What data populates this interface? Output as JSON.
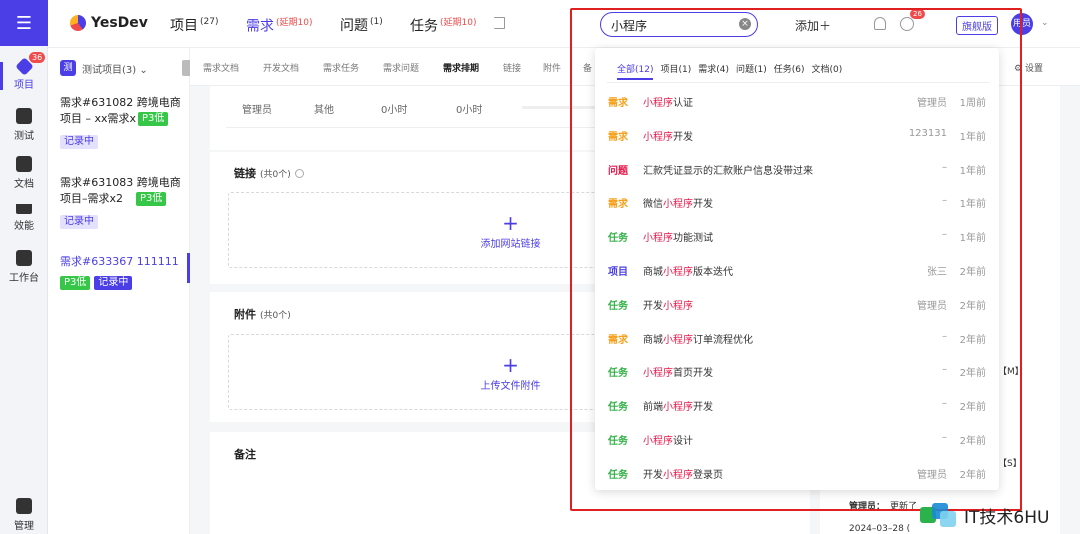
{
  "rail": {
    "badge": "36",
    "items": [
      {
        "label": "项目",
        "icon": "project-icon"
      },
      {
        "label": "测试",
        "icon": "test-icon"
      },
      {
        "label": "文档",
        "icon": "doc-icon"
      },
      {
        "label": "效能",
        "icon": "efficiency-icon"
      },
      {
        "label": "工作台",
        "icon": "workbench-icon"
      },
      {
        "label": "管理",
        "icon": "manage-icon"
      }
    ]
  },
  "topbar": {
    "brand": "YesDev",
    "nav": [
      {
        "label": "项目",
        "count": "(27)",
        "delay": ""
      },
      {
        "label": "需求",
        "count": "",
        "delay": "(延期10)"
      },
      {
        "label": "问题",
        "count": "(1)",
        "delay": ""
      },
      {
        "label": "任务",
        "count": "",
        "delay": "(延期10)"
      }
    ],
    "search_value": "小程序",
    "search_clear": "×",
    "add_label": "添加＋",
    "clock_badge": "26",
    "edition": "旗舰版",
    "avatar": "用员"
  },
  "list": {
    "project_icon": "测",
    "project_label": "测试项目(3) ⌄",
    "items": [
      {
        "title": "需求#631082 跨境电商项目 – xx需求x",
        "priority": "P3低",
        "status": "记录中"
      },
      {
        "title": "需求#631083 跨境电商项目–需求x2",
        "priority": "P3低",
        "status": "记录中"
      },
      {
        "title": "需求#633367 111111",
        "priority": "P3低",
        "status": "记录中"
      }
    ]
  },
  "tabs": [
    "需求文档",
    "开发文档",
    "需求任务",
    "需求问题",
    "需求排期",
    "链接",
    "附件",
    "备"
  ],
  "settings_label": "设置",
  "main": {
    "row": [
      "管理员",
      "其他",
      "0小时",
      "0小时"
    ],
    "links_title": "链接",
    "links_count": "(共0个)",
    "add_link": "添加网站链接",
    "attach_title": "附件",
    "attach_count": "(共0个)",
    "upload": "上传文件附件",
    "notes_title": "备注"
  },
  "right_panel": {
    "m_text": "【M】：",
    "s_text": "【S】",
    "admin": "管理员：",
    "update": "更新了",
    "date": "2024–03–28 ("
  },
  "dropdown": {
    "filters": [
      "全部(12)",
      "项目(1)",
      "需求(4)",
      "问题(1)",
      "任务(6)",
      "文档(0)"
    ],
    "keyword": "小程序",
    "results": [
      {
        "type": "需求",
        "kind": "req",
        "pre": "",
        "post": "认证",
        "owner": "管理员",
        "time": "1周前"
      },
      {
        "type": "需求",
        "kind": "req",
        "pre": "",
        "post": "开发",
        "owner": "123131",
        "time": "1年前"
      },
      {
        "type": "问题",
        "kind": "bug",
        "pre": "汇款凭证显示的汇款账户信息没带过来",
        "post": "",
        "owner": "–",
        "time": "1年前",
        "plain": true
      },
      {
        "type": "需求",
        "kind": "req",
        "pre": "微信",
        "post": "开发",
        "owner": "–",
        "time": "1年前"
      },
      {
        "type": "任务",
        "kind": "task",
        "pre": "",
        "post": "功能测试",
        "owner": "–",
        "time": "1年前"
      },
      {
        "type": "项目",
        "kind": "proj",
        "pre": "商城",
        "post": "版本迭代",
        "owner": "张三",
        "time": "2年前"
      },
      {
        "type": "任务",
        "kind": "task",
        "pre": "开发",
        "post": "",
        "owner": "管理员",
        "time": "2年前"
      },
      {
        "type": "需求",
        "kind": "req",
        "pre": "商城",
        "post": "订单流程优化",
        "owner": "–",
        "time": "2年前"
      },
      {
        "type": "任务",
        "kind": "task",
        "pre": "",
        "post": "首页开发",
        "owner": "–",
        "time": "2年前"
      },
      {
        "type": "任务",
        "kind": "task",
        "pre": "前端",
        "post": "开发",
        "owner": "–",
        "time": "2年前"
      },
      {
        "type": "任务",
        "kind": "task",
        "pre": "",
        "post": "设计",
        "owner": "–",
        "time": "2年前"
      },
      {
        "type": "任务",
        "kind": "task",
        "pre": "开发",
        "post": "登录页",
        "owner": "管理员",
        "time": "2年前"
      }
    ]
  },
  "watermark": "IT技术6HU",
  "colors": {
    "accent": "#4b3ee6",
    "danger": "#e6194b",
    "req": "#f5a11d",
    "task": "#37b34a",
    "annotation": "#e02020"
  }
}
